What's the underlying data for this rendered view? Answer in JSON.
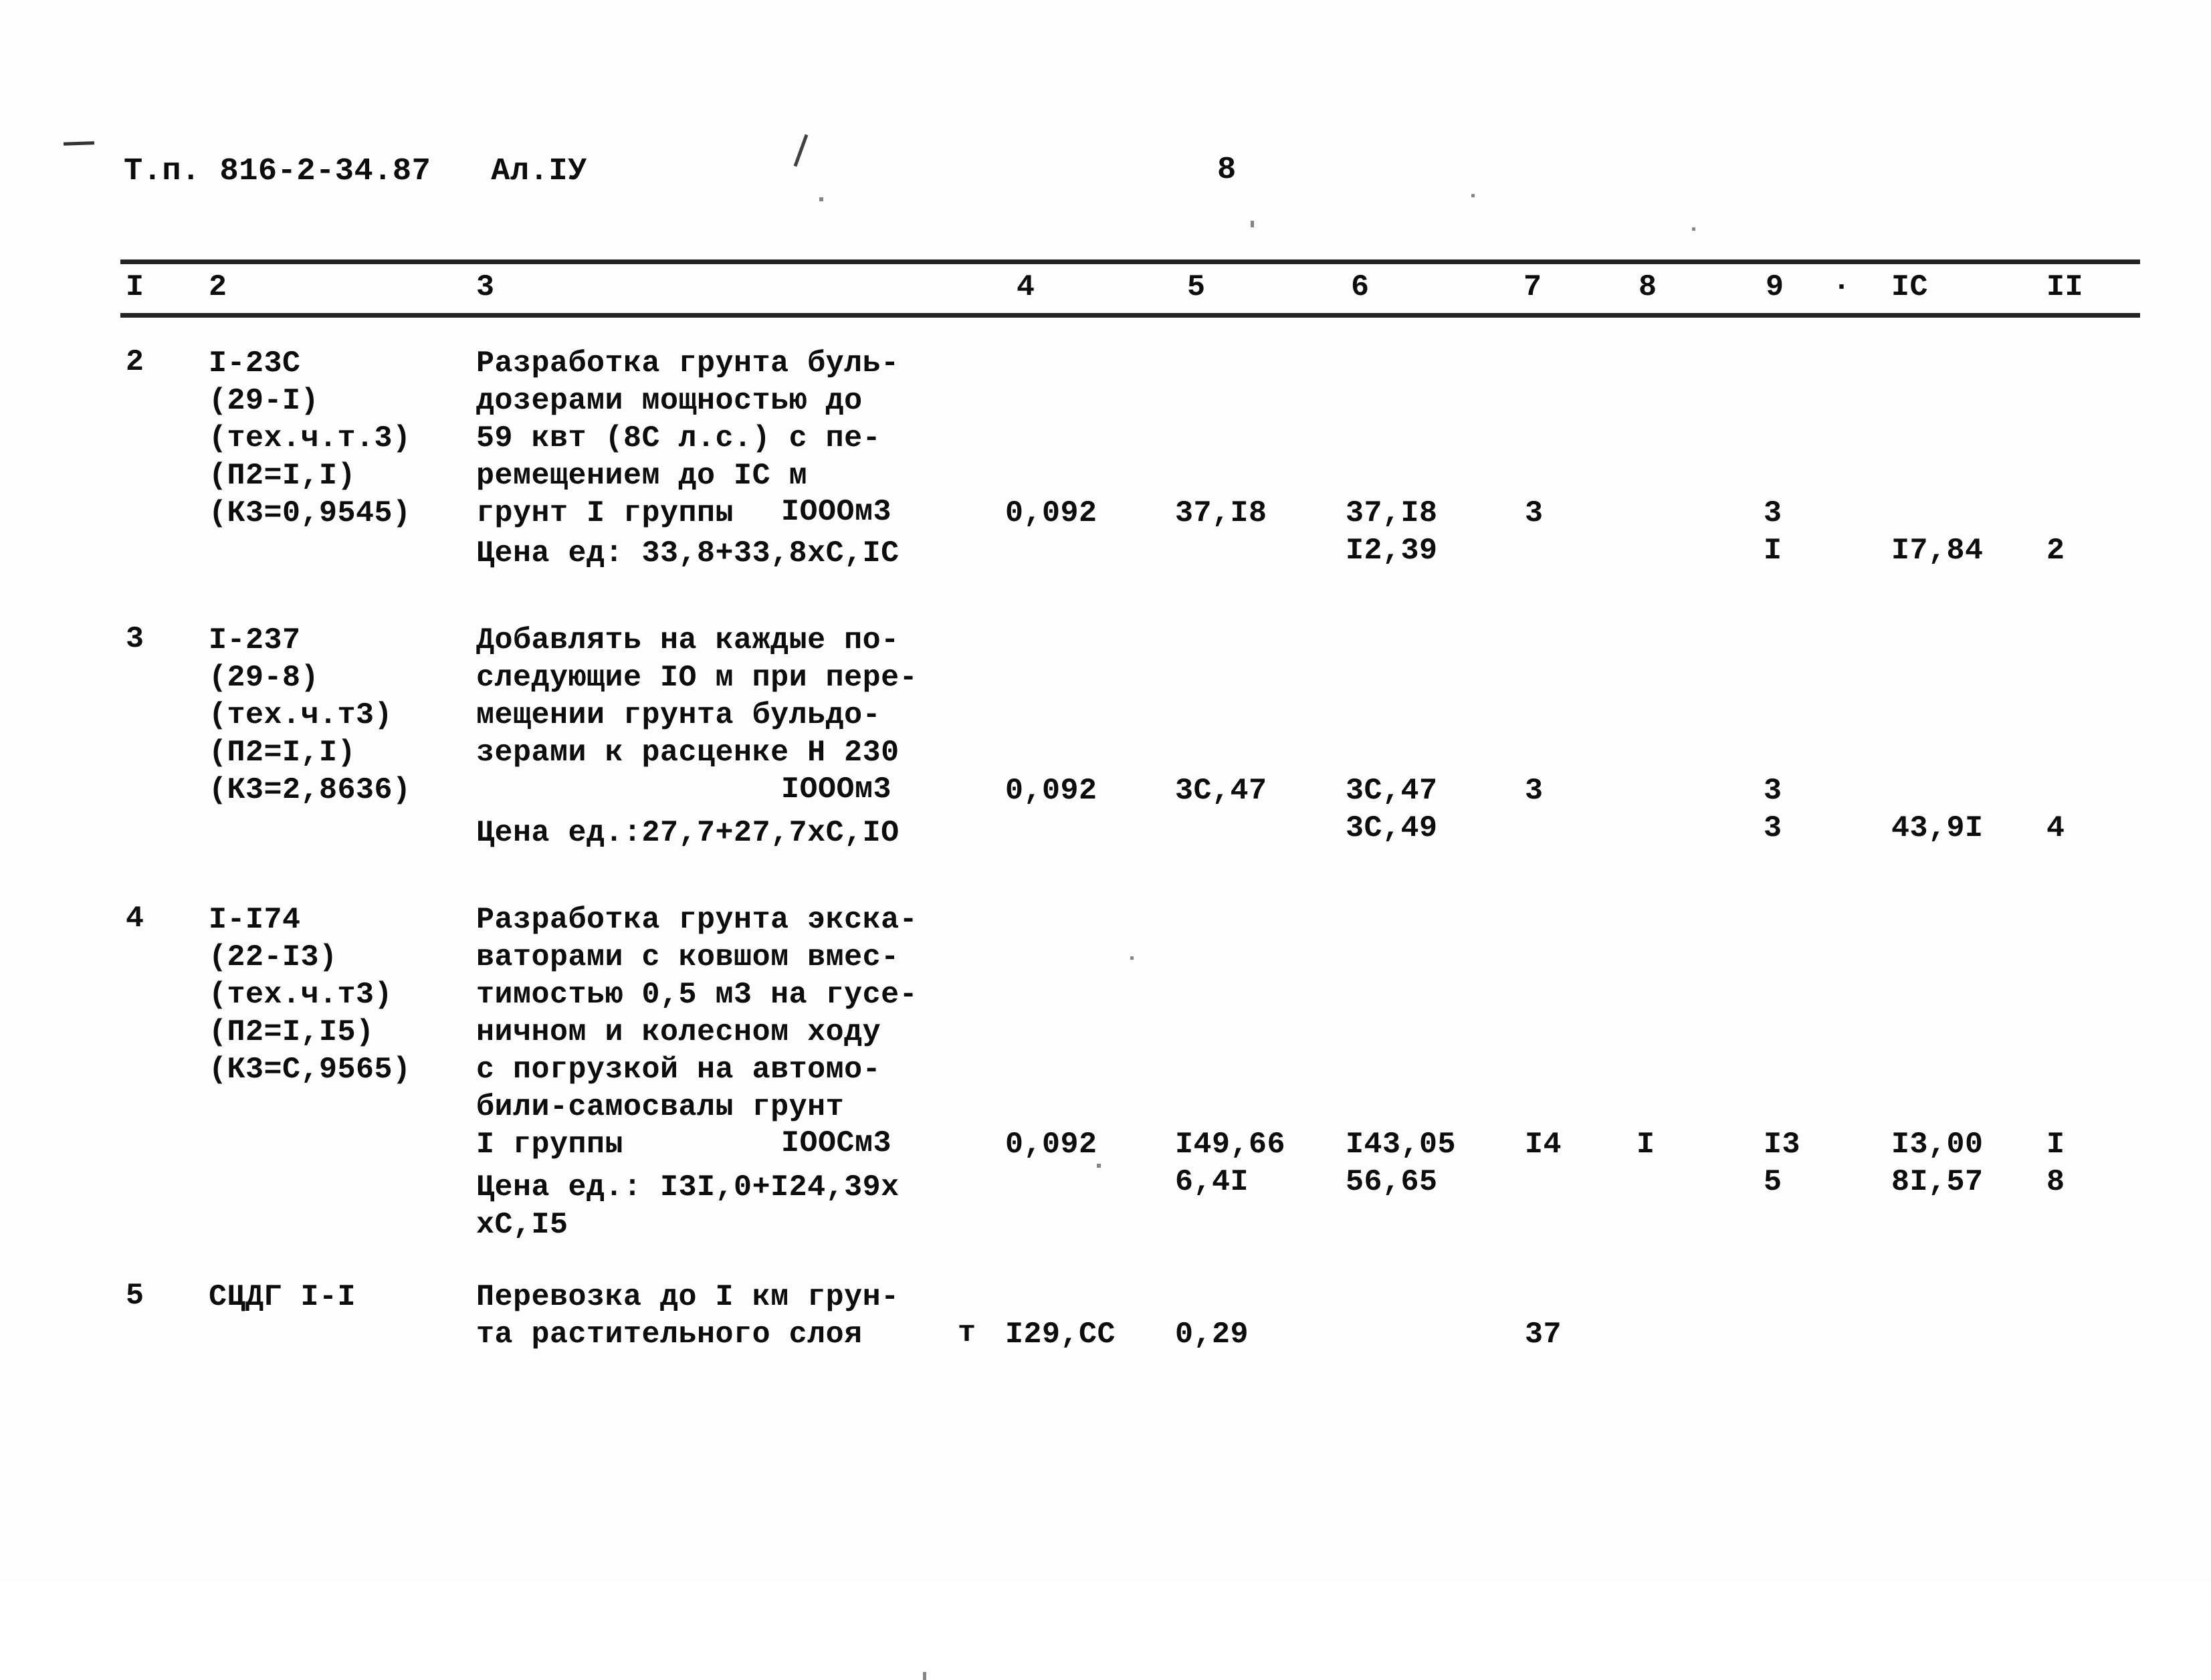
{
  "document": {
    "header": {
      "sheet_code": "Т.п. 816-2-34.87",
      "album": "Ал.IУ",
      "page_number": "8"
    },
    "table": {
      "column_headers": [
        "I",
        "2",
        "3",
        "4",
        "5",
        "6",
        "7",
        "8",
        "9",
        "IC",
        "II"
      ],
      "rows": [
        {
          "num": "2",
          "code_lines": "I-23C\n(29-I)\n(тех.ч.т.3)\n(П2=I,I)\n(К3=0,9545)",
          "desc_lines": "Разработка грунта буль-\nдозерами мощностью до\n59 квт (8C л.с.) с пе-\nремещением до IC м\nгрунт I группы",
          "unit": "IOOOм3",
          "price_note": "Цена ед: 33,8+33,8xC,IC",
          "col4": "0,092",
          "col5": "37,I8",
          "col6": "37,I8\nI2,39",
          "col7": "3",
          "col8": "",
          "col9": "3\nI",
          "col10": "\nI7,84",
          "col11": "\n2"
        },
        {
          "num": "3",
          "code_lines": "I-237\n(29-8)\n(тех.ч.т3)\n(П2=I,I)\n(К3=2,8636)",
          "desc_lines": "Добавлять на каждые по-\nследующие IO м при пере-\nмещении грунта бульдо-\nзерами к расценке Н 230",
          "unit": "IOOOм3",
          "price_note": "Цена ед.:27,7+27,7xC,IO",
          "col4": "0,092",
          "col5": "3C,47",
          "col6": "3C,47\n3C,49",
          "col7": "3",
          "col8": "",
          "col9": "3\n3",
          "col10": "\n43,9I",
          "col11": "\n4"
        },
        {
          "num": "4",
          "code_lines": "I-I74\n(22-I3)\n(тех.ч.т3)\n(П2=I,I5)\n(К3=C,9565)",
          "desc_lines": "Разработка грунта экска-\nваторами с ковшом вмес-\nтимостью 0,5 м3 на гусе-\nничном и колесном ходу\nс погрузкой на автомо-\nбили-самосвалы грунт\nI группы",
          "unit": "IOOCм3",
          "price_note": "Цена ед.: I3I,0+I24,39х\nхC,I5",
          "col4": "0,092",
          "col5": "I49,66\n6,4I",
          "col6": "I43,05\n56,65",
          "col7": "I4",
          "col8": "I",
          "col9": "I3\n5",
          "col10": "I3,00\n8I,57",
          "col11": "I\n8"
        },
        {
          "num": "5",
          "code_lines": "СЦДГ I-I",
          "desc_lines": "Перевозка до I км грун-\nта растительного слоя",
          "unit": "т",
          "price_note": "",
          "col4": "I29,CC",
          "col5": "0,29",
          "col6": "",
          "col7": "37",
          "col8": "",
          "col9": "",
          "col10": "",
          "col11": ""
        }
      ]
    }
  }
}
